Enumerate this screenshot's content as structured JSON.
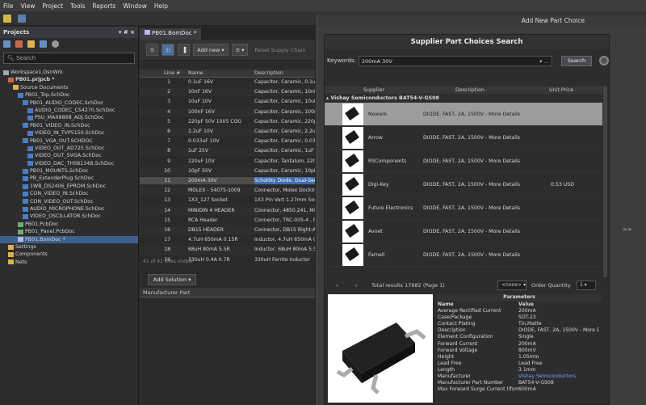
{
  "menu": [
    "File",
    "View",
    "Project",
    "Tools",
    "Reports",
    "Window",
    "Help"
  ],
  "projects_panel": {
    "title": "Projects",
    "controls": "▾ # ×",
    "search_placeholder": "Search",
    "tree": [
      {
        "label": "Workspace1.DsnWrk",
        "icon": "ws",
        "indent": 0
      },
      {
        "label": "PB01.prjpcb *",
        "icon": "prj",
        "indent": 1,
        "bold": true
      },
      {
        "label": "Source Documents",
        "icon": "fld",
        "indent": 2
      },
      {
        "label": "PB01_Top.SchDoc",
        "icon": "doc",
        "indent": 3
      },
      {
        "label": "PB01_AUDIO_CODEC.SchDoc",
        "icon": "doc",
        "indent": 4
      },
      {
        "label": "AUDIO_CODEC_CS4270.SchDoc",
        "icon": "doc",
        "indent": 5
      },
      {
        "label": "PSU_MAX8868_ADJ.SchDoc",
        "icon": "doc",
        "indent": 5
      },
      {
        "label": "PB01_VIDEO_IN.SchDoc",
        "icon": "doc",
        "indent": 4
      },
      {
        "label": "VIDEO_IN_TVP5150.SchDoc",
        "icon": "doc",
        "indent": 5
      },
      {
        "label": "PB01_VGA_OUT.SCHDOC",
        "icon": "doc",
        "indent": 4
      },
      {
        "label": "VIDEO_OUT_AD725.SchDoc",
        "icon": "doc",
        "indent": 5
      },
      {
        "label": "VIDEO_OUT_SVGA.SchDoc",
        "icon": "doc",
        "indent": 5
      },
      {
        "label": "VIDEO_DAC_THS8134B.SchDoc",
        "icon": "doc",
        "indent": 5
      },
      {
        "label": "PB01_MOUNTS.SchDoc",
        "icon": "doc",
        "indent": 4
      },
      {
        "label": "PB_ExtenderPlug.SchDoc",
        "icon": "doc",
        "indent": 4
      },
      {
        "label": "1WB_DS2406_EPROM.SchDoc",
        "icon": "doc",
        "indent": 4
      },
      {
        "label": "CON_VIDEO_IN.SchDoc",
        "icon": "doc",
        "indent": 4
      },
      {
        "label": "CON_VIDEO_OUT.SchDoc",
        "icon": "doc",
        "indent": 4
      },
      {
        "label": "AUDIO_MICROPHONE.SchDoc",
        "icon": "doc",
        "indent": 4
      },
      {
        "label": "VIDEO_OSCILLATOR.SchDoc",
        "icon": "doc",
        "indent": 4
      },
      {
        "label": "PB01.PcbDoc",
        "icon": "pcb",
        "indent": 3
      },
      {
        "label": "PB01_Panel.PcbDoc",
        "icon": "pcb",
        "indent": 3
      },
      {
        "label": "PB01.BomDoc *",
        "icon": "bom",
        "indent": 3,
        "selected": true
      },
      {
        "label": "Settings",
        "icon": "fld",
        "indent": 1
      },
      {
        "label": "Components",
        "icon": "fld",
        "indent": 1
      },
      {
        "label": "Nets",
        "icon": "fld",
        "indent": 1
      }
    ]
  },
  "document": {
    "tab": "PB01.BomDoc *",
    "add_new": "Add new ▾",
    "reset_supply_chain": "Reset Supply Chain",
    "columns": [
      "Line #",
      "Name",
      "Description"
    ],
    "rows": [
      {
        "line": "1",
        "name": "0.1uF 16V",
        "desc": "Capacitor, Ceramic, 0.1uF"
      },
      {
        "line": "2",
        "name": "10nF 16V",
        "desc": "Capacitor, Ceramic, 10nF"
      },
      {
        "line": "3",
        "name": "10uF 10V",
        "desc": "Capacitor, Ceramic, 10uF"
      },
      {
        "line": "4",
        "name": "100nF 16V",
        "desc": "Capacitor, Ceramic, 100nF"
      },
      {
        "line": "5",
        "name": "220pF 50V 1005 COG",
        "desc": "Capacitor, Ceramic, 220pF"
      },
      {
        "line": "6",
        "name": "2.2uF 10V",
        "desc": "Capacitor, Ceramic, 2.2uF"
      },
      {
        "line": "7",
        "name": "0.033uF 10V",
        "desc": "Capacitor, Ceramic, 0.033"
      },
      {
        "line": "8",
        "name": "1uF 25V",
        "desc": "Capacitor, Ceramic, 1uF 1"
      },
      {
        "line": "9",
        "name": "220uF 10V",
        "desc": "Capacitor, Tantalum, 220u"
      },
      {
        "line": "10",
        "name": "10pF 50V",
        "desc": "Capacitor, Ceramic, 10pF"
      },
      {
        "line": "11",
        "name": "200mA 30V",
        "desc": "Schottky Diode, Dual-Serie",
        "selected": true
      },
      {
        "line": "12",
        "name": "MOLEX - 54075-1009",
        "desc": "Connector, Molex Docking"
      },
      {
        "line": "13",
        "name": "1X3_127 Socket",
        "desc": "1X3 Pin Vert 1.27mm Sock"
      },
      {
        "line": "14",
        "name": "MINIDIN 4 HEADER",
        "desc": "Connector, 4850.241, Mini"
      },
      {
        "line": "15",
        "name": "RCA Header",
        "desc": "Connector, TRC-005-4 , R"
      },
      {
        "line": "16",
        "name": "DB15 HEADER",
        "desc": "Connector, DB15 Right-An"
      },
      {
        "line": "17",
        "name": "4.7uH 650mA 0.15R",
        "desc": "Inductor, 4.7uH 650mA 0."
      },
      {
        "line": "18",
        "name": "68uH 80mA 5.5R",
        "desc": "Inductor, 68uH 80mA 5.5R"
      },
      {
        "line": "19",
        "name": "330uH 0.4A 0.7R",
        "desc": "330uH Ferrite Inductor"
      }
    ],
    "status": "41 of 41 lines visible",
    "add_solution": "Add Solution ▾",
    "manufacturer_part_header": "Manufacturer Part"
  },
  "dialog": {
    "window_title": "Add New Part Choice",
    "title": "Supplier Part Choices Search",
    "keywords_label": "Keywords:",
    "keywords_value": "200mA 30V",
    "search_button": "Search",
    "columns": [
      "Supplier",
      "Description",
      "Unit Price"
    ],
    "group": "▴ Vishay Semiconductors BAT54-V-GS08",
    "results": [
      {
        "supplier": "Newark",
        "desc": "DIODE, FAST, 2A, 1500V - More Details",
        "price": "",
        "selected": true
      },
      {
        "supplier": "Arrow",
        "desc": "DIODE, FAST, 2A, 1500V - More Details",
        "price": ""
      },
      {
        "supplier": "RSComponents",
        "desc": "DIODE, FAST, 2A, 1500V - More Details",
        "price": ""
      },
      {
        "supplier": "Digi-Key",
        "desc": "DIODE, FAST, 2A, 1500V - More Details",
        "price": "0.53 USD"
      },
      {
        "supplier": "Future Electronics",
        "desc": "DIODE, FAST, 2A, 1500V - More Details",
        "price": ""
      },
      {
        "supplier": "Avnet",
        "desc": "DIODE, FAST, 2A, 1500V - More Details",
        "price": ""
      },
      {
        "supplier": "Farnell",
        "desc": "DIODE, FAST, 2A, 1500V - More Details",
        "price": ""
      }
    ],
    "total_results": "Total results 17682 (Page 1)",
    "none_select": "<none>",
    "order_qty_label": "Order Quantity",
    "order_qty_value": "1",
    "expand": ">>",
    "params_title": "Parameters",
    "params_header": [
      "Name",
      "Value"
    ],
    "params": [
      {
        "name": "Average Rectified Current",
        "value": "200mA"
      },
      {
        "name": "Case/Package",
        "value": "SOT-23"
      },
      {
        "name": "Contact Plating",
        "value": "Tin,Matte"
      },
      {
        "name": "Description",
        "value": "DIODE, FAST, 2A, 1500V - More De"
      },
      {
        "name": "Element Configuration",
        "value": "Single"
      },
      {
        "name": "Forward Current",
        "value": "200mA"
      },
      {
        "name": "Forward Voltage",
        "value": "800mV"
      },
      {
        "name": "Height",
        "value": "1.05mm"
      },
      {
        "name": "Lead Free",
        "value": "Lead Free"
      },
      {
        "name": "Length",
        "value": "3.1mm"
      },
      {
        "name": "Manufacturer",
        "value": "Vishay Semiconductors",
        "link": true
      },
      {
        "name": "Manufacturer Part Number",
        "value": "BAT54-V-GS08"
      },
      {
        "name": "Max Forward Surge Current (Ifsm)",
        "value": "600mA"
      }
    ]
  }
}
